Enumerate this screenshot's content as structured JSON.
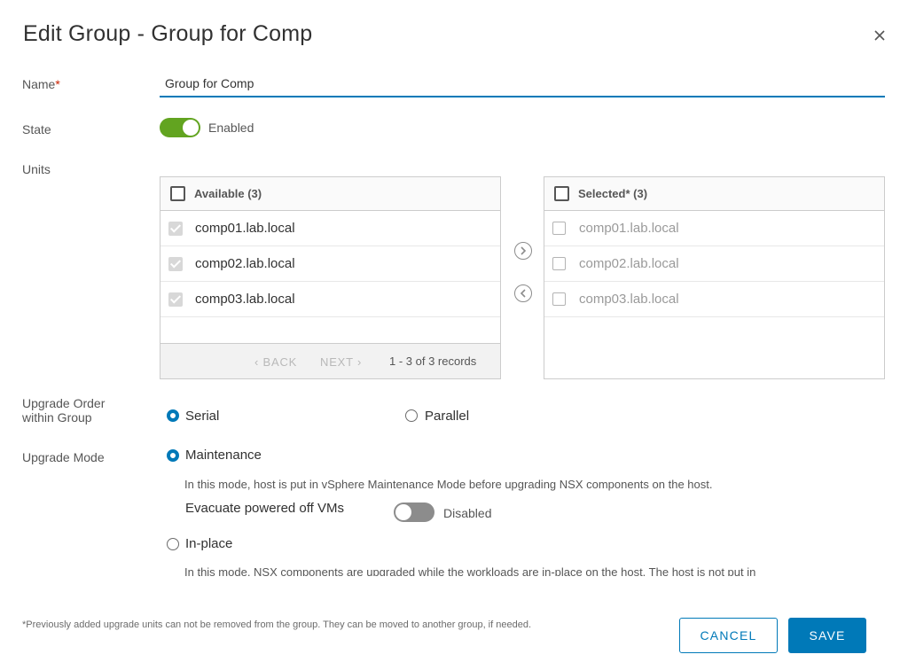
{
  "dialog": {
    "title": "Edit Group - Group for Comp"
  },
  "form": {
    "name_label": "Name",
    "name_required_mark": "*",
    "name_value": "Group for Comp",
    "state_label": "State",
    "state_toggle_text": "Enabled",
    "state_enabled": true,
    "units_label": "Units"
  },
  "available": {
    "header": "Available (3)",
    "rows": [
      "comp01.lab.local",
      "comp02.lab.local",
      "comp03.lab.local"
    ],
    "back_label": "‹ BACK",
    "next_label": "NEXT ›",
    "records": "1 - 3 of 3 records"
  },
  "selected": {
    "header": "Selected* (3)",
    "rows": [
      "comp01.lab.local",
      "comp02.lab.local",
      "comp03.lab.local"
    ]
  },
  "upgrade_order": {
    "label_line1": "Upgrade Order",
    "label_line2": "within Group",
    "options": [
      "Serial",
      "Parallel"
    ],
    "selected": "Serial"
  },
  "upgrade_mode": {
    "label": "Upgrade Mode",
    "maintenance_label": "Maintenance",
    "maintenance_desc": "In this mode, host is put in vSphere Maintenance Mode before upgrading NSX components on the host.",
    "evacuate_label": "Evacuate powered off VMs",
    "evacuate_toggle_text": "Disabled",
    "evacuate_enabled": false,
    "inplace_label": "In-place",
    "inplace_desc": "In this mode, NSX components are upgraded while the workloads are in-place on the host. The host is not put in",
    "selected": "Maintenance"
  },
  "footer": {
    "footnote": "*Previously added upgrade units can not be removed from the group. They can be moved to another group, if needed.",
    "cancel_label": "CANCEL",
    "save_label": "SAVE"
  },
  "colors": {
    "accent": "#0079b8",
    "toggle_on": "#62a420",
    "toggle_off": "#8c8c8c",
    "required": "#c92100"
  },
  "icons": [
    "close-icon",
    "chevron-right-icon",
    "chevron-left-icon"
  ]
}
